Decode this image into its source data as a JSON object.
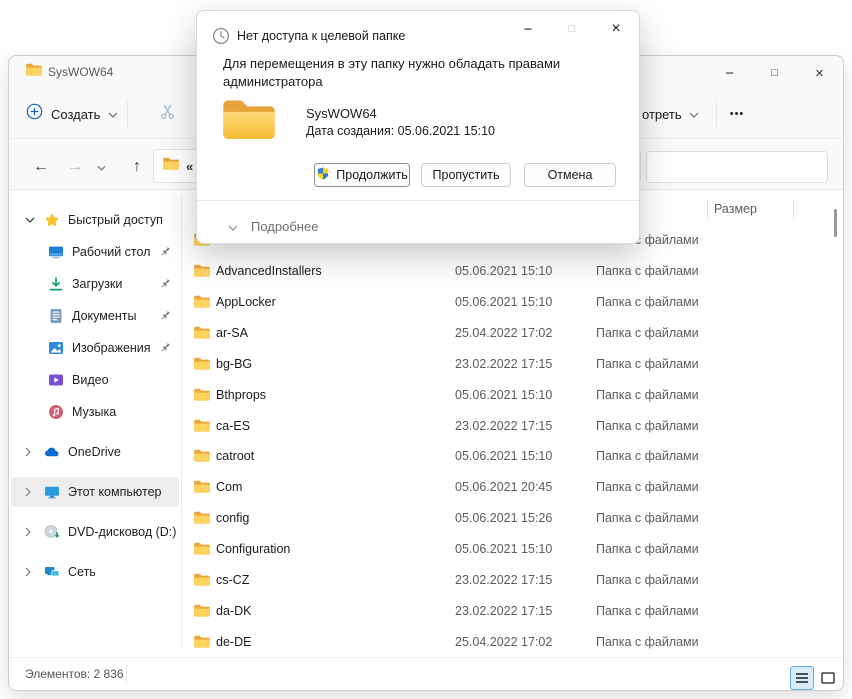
{
  "dialog": {
    "title": "Нет доступа к целевой папке",
    "message": "Для перемещения в эту папку нужно обладать правами администратора",
    "folder_name": "SysWOW64",
    "folder_created": "Дата создания: 05.06.2021 15:10",
    "continue_label": "Продолжить",
    "skip_label": "Пропустить",
    "cancel_label": "Отмена",
    "details_label": "Подробнее",
    "minimize_glyph": "−",
    "maximize_glyph": "□",
    "close_glyph": "×"
  },
  "explorer": {
    "title": "SysWOW64",
    "window_controls": {
      "minimize_glyph": "−",
      "maximize_glyph": "□",
      "close_glyph": "×"
    },
    "toolbar": {
      "new_label": "Создать",
      "view_label_partial": "отреть",
      "more_glyph": "•••"
    },
    "nav": {
      "back_glyph": "←",
      "forward_glyph": "→",
      "up_glyph": "↑",
      "address_collapse_glyph": "«"
    },
    "search_value": "",
    "columns": {
      "size": "Размер"
    },
    "sidebar": [
      {
        "label": "Быстрый доступ"
      },
      {
        "label": "Рабочий стол"
      },
      {
        "label": "Загрузки"
      },
      {
        "label": "Документы"
      },
      {
        "label": "Изображения"
      },
      {
        "label": "Видео"
      },
      {
        "label": "Музыка"
      },
      {
        "label": "OneDrive"
      },
      {
        "label": "Этот компьютер"
      },
      {
        "label": "DVD-дисковод (D:)"
      },
      {
        "label": "Сеть"
      }
    ],
    "files": [
      {
        "name": "",
        "date": "",
        "type": "Папка с файлами"
      },
      {
        "name": "AdvancedInstallers",
        "date": "05.06.2021 15:10",
        "type": "Папка с файлами"
      },
      {
        "name": "AppLocker",
        "date": "05.06.2021 15:10",
        "type": "Папка с файлами"
      },
      {
        "name": "ar-SA",
        "date": "25.04.2022 17:02",
        "type": "Папка с файлами"
      },
      {
        "name": "bg-BG",
        "date": "23.02.2022 17:15",
        "type": "Папка с файлами"
      },
      {
        "name": "Bthprops",
        "date": "05.06.2021 15:10",
        "type": "Папка с файлами"
      },
      {
        "name": "ca-ES",
        "date": "23.02.2022 17:15",
        "type": "Папка с файлами"
      },
      {
        "name": "catroot",
        "date": "05.06.2021 15:10",
        "type": "Папка с файлами"
      },
      {
        "name": "Com",
        "date": "05.06.2021 20:45",
        "type": "Папка с файлами"
      },
      {
        "name": "config",
        "date": "05.06.2021 15:26",
        "type": "Папка с файлами"
      },
      {
        "name": "Configuration",
        "date": "05.06.2021 15:10",
        "type": "Папка с файлами"
      },
      {
        "name": "cs-CZ",
        "date": "23.02.2022 17:15",
        "type": "Папка с файлами"
      },
      {
        "name": "da-DK",
        "date": "23.02.2022 17:15",
        "type": "Папка с файлами"
      },
      {
        "name": "de-DE",
        "date": "25.04.2022 17:02",
        "type": "Папка с файлами"
      }
    ],
    "status": {
      "items": "Элементов: 2 836"
    }
  },
  "colors": {
    "accent_blue": "#1b66b8",
    "folder_front": "#ffd35f",
    "folder_back": "#eaa83e",
    "uac_blue": "#2f7fd6",
    "uac_yellow": "#f5d327",
    "view_selected_bg": "#d9ecf9",
    "view_selected_border": "#62aede"
  }
}
